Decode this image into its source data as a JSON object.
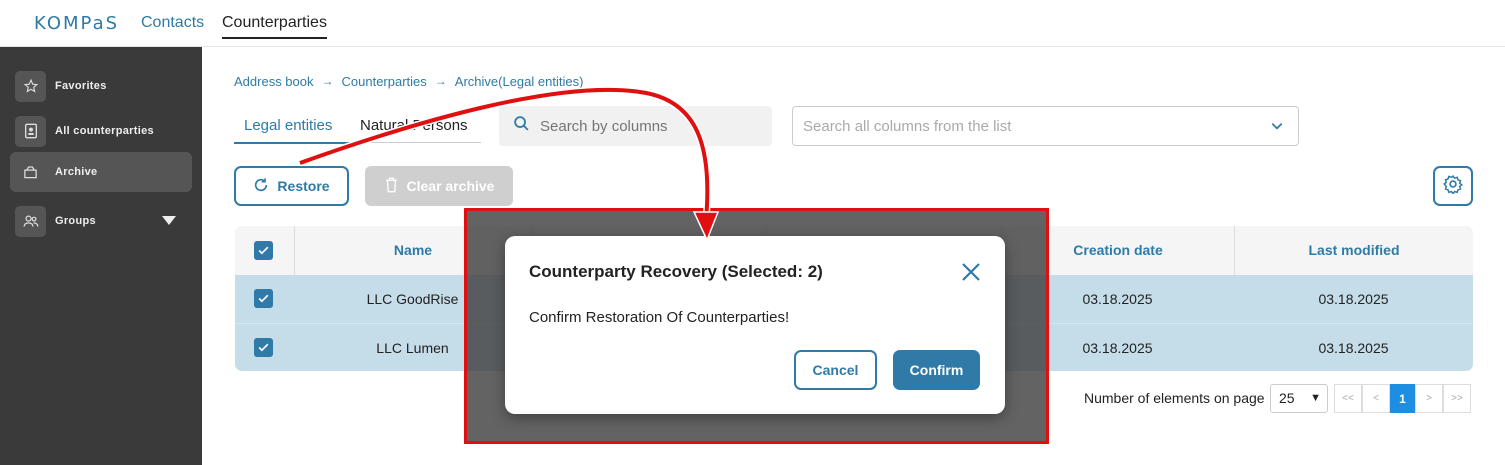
{
  "app": {
    "logo": "KOMPaS",
    "nav": [
      {
        "label": "Contacts"
      },
      {
        "label": "Counterparties"
      }
    ]
  },
  "sidebar": {
    "items": [
      {
        "label": "Favorites",
        "icon": "star-icon"
      },
      {
        "label": "All counterparties",
        "icon": "contact-card-icon"
      },
      {
        "label": "Archive",
        "icon": "archive-box-icon"
      },
      {
        "label": "Groups",
        "icon": "group-users-icon"
      }
    ]
  },
  "breadcrumb": [
    "Address book",
    "Counterparties",
    "Archive(Legal entities)"
  ],
  "tabs": [
    {
      "label": "Legal entities"
    },
    {
      "label": "Natural Persons"
    }
  ],
  "search": {
    "placeholder": "Search by columns"
  },
  "column_filter": {
    "placeholder": "Search all columns from the list"
  },
  "toolbar": {
    "restore_label": "Restore",
    "clear_archive_label": "Clear archive"
  },
  "table": {
    "columns": [
      "Name",
      "Creation date",
      "Last modified"
    ],
    "rows": [
      {
        "name": "LLC GoodRise",
        "created": "03.18.2025",
        "modified": "03.18.2025"
      },
      {
        "name": "LLC Lumen",
        "created": "03.18.2025",
        "modified": "03.18.2025"
      }
    ]
  },
  "pagination": {
    "label": "Number of elements on page",
    "page_size": "25",
    "first": "<<",
    "prev": "<",
    "current": "1",
    "next": ">",
    "last": ">>"
  },
  "modal": {
    "title": "Counterparty Recovery (Selected: 2)",
    "message": "Confirm Restoration Of Counterparties!",
    "cancel_label": "Cancel",
    "confirm_label": "Confirm"
  },
  "colors": {
    "accent": "#2f7aa6",
    "sidebar_bg": "#3a3a3a",
    "selected_row": "#c5dce9",
    "annotation_red": "#e01010"
  }
}
